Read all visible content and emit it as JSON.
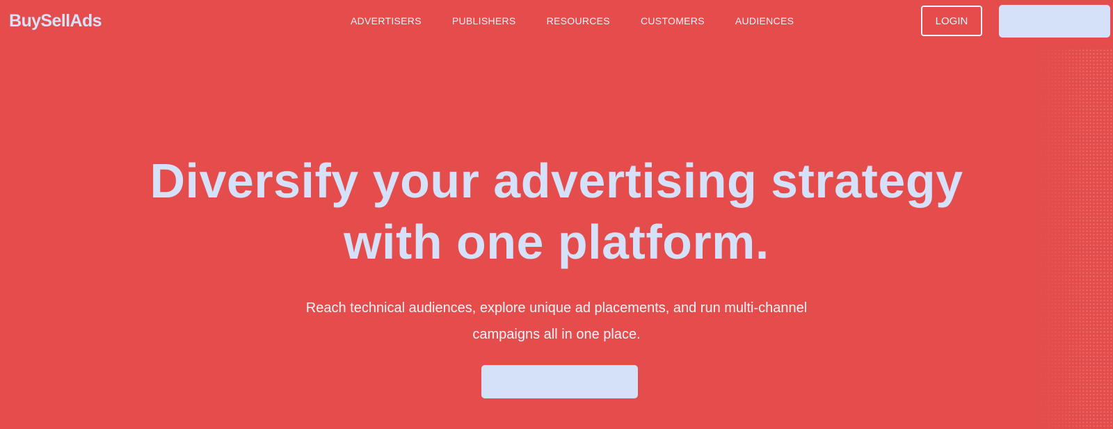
{
  "brand": {
    "logo_text": "BuySellAds"
  },
  "nav": {
    "items": [
      {
        "label": "ADVERTISERS"
      },
      {
        "label": "PUBLISHERS"
      },
      {
        "label": "RESOURCES"
      },
      {
        "label": "CUSTOMERS"
      },
      {
        "label": "AUDIENCES"
      }
    ]
  },
  "header_actions": {
    "login_label": "LOGIN"
  },
  "hero": {
    "title": "Diversify your advertising strategy with one platform.",
    "subtitle": "Reach technical audiences, explore unique ad placements, and run multi-channel campaigns all in one place."
  },
  "colors": {
    "background": "#e44d4c",
    "accent_light": "#d5e1f9",
    "text_light": "#f1f3fb"
  }
}
